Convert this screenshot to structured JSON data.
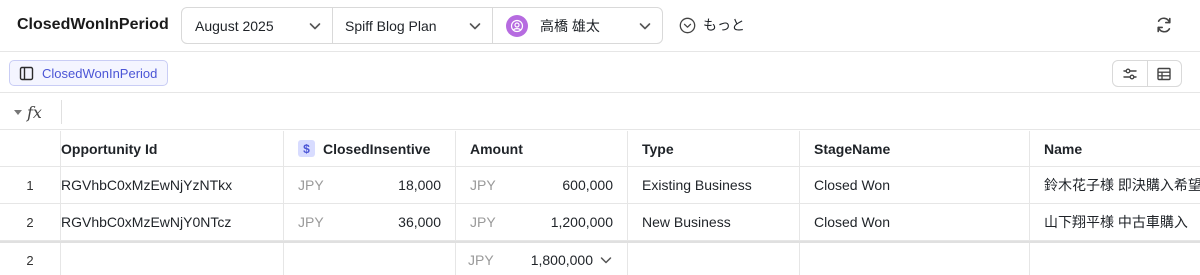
{
  "app": {
    "title": "ClosedWonInPeriod"
  },
  "filters": {
    "month": "August 2025",
    "plan": "Spiff Blog Plan",
    "user": "高橋 雄太",
    "more_label": "もっと"
  },
  "table_tag": {
    "label": "ClosedWonInPeriod"
  },
  "formula_bar": {
    "fx_label": "fx"
  },
  "columns": [
    "Opportunity Id",
    "ClosedInsentive",
    "Amount",
    "Type",
    "StageName",
    "Name"
  ],
  "rows": [
    {
      "num": "1",
      "opportunity_id": "RGVhbC0xMzEwNjYzNTkx",
      "insentive_currency": "JPY",
      "insentive": "18,000",
      "amount_currency": "JPY",
      "amount": "600,000",
      "type": "Existing Business",
      "stage": "Closed Won",
      "name": "鈴木花子様 即決購入希望"
    },
    {
      "num": "2",
      "opportunity_id": "RGVhbC0xMzEwNjY0NTcz",
      "insentive_currency": "JPY",
      "insentive": "36,000",
      "amount_currency": "JPY",
      "amount": "1,200,000",
      "type": "New Business",
      "stage": "Closed Won",
      "name": "山下翔平様 中古車購入"
    }
  ],
  "totals": {
    "count": "2",
    "amount_currency": "JPY",
    "amount": "1,800,000"
  },
  "colors": {
    "accent": "#4b55d6",
    "avatar": "#b66be0",
    "border": "#e6e6e6"
  }
}
